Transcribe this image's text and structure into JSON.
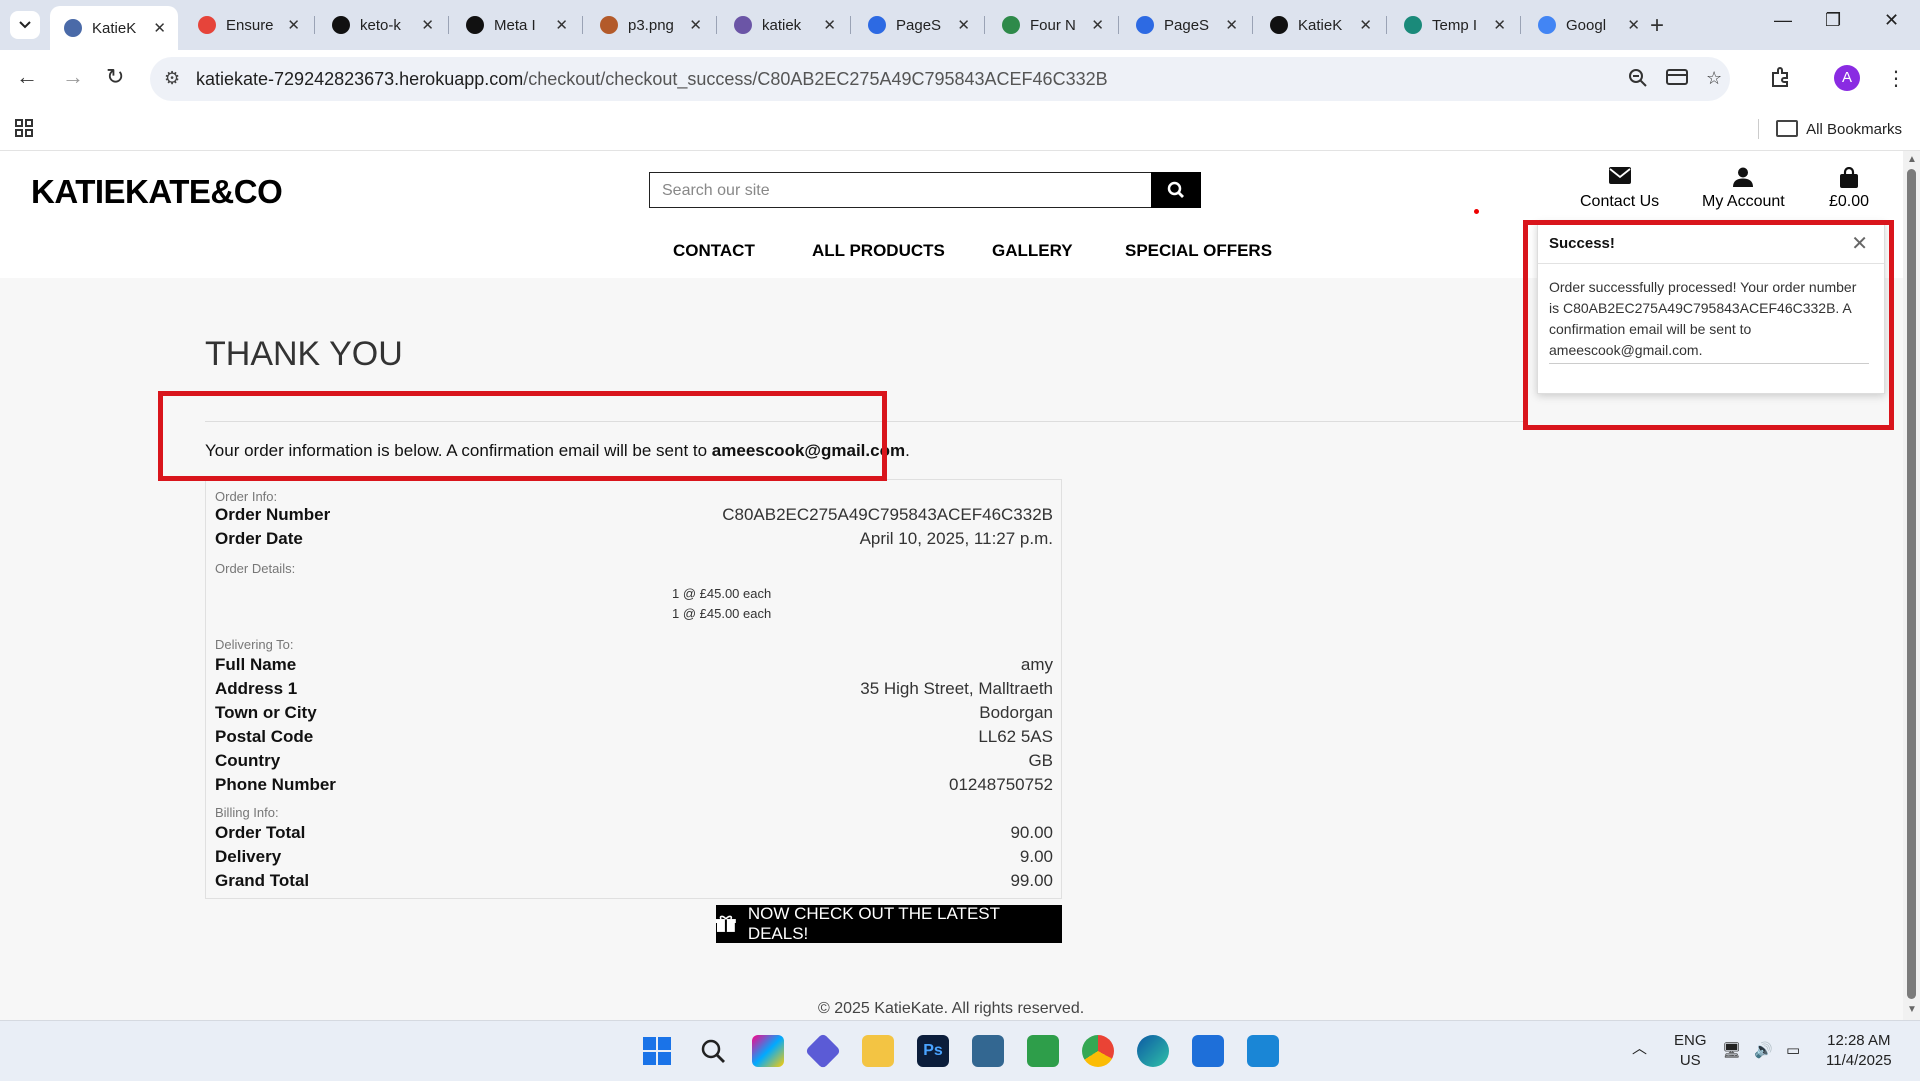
{
  "browser": {
    "tabs": [
      {
        "title": "KatieK",
        "active": true,
        "icon": "globe-icon",
        "color": "#4a6aa8"
      },
      {
        "title": "Ensure",
        "icon": "chrome-icon",
        "color": "#e6443a"
      },
      {
        "title": "keto-k",
        "icon": "github-icon",
        "color": "#111111"
      },
      {
        "title": "Meta I",
        "icon": "threads-icon",
        "color": "#111111"
      },
      {
        "title": "p3.png",
        "icon": "image-icon",
        "color": "#b35a2a"
      },
      {
        "title": "katiek",
        "icon": "heroku-icon",
        "color": "#6b55a6"
      },
      {
        "title": "PageS",
        "icon": "pagespeed-icon",
        "color": "#2d6ae3"
      },
      {
        "title": "Four N",
        "icon": "leaf-icon",
        "color": "#2e8a4a"
      },
      {
        "title": "PageS",
        "icon": "pagespeed-icon",
        "color": "#2d6ae3"
      },
      {
        "title": "KatieK",
        "icon": "github-icon",
        "color": "#111111"
      },
      {
        "title": "Temp I",
        "icon": "code-institute-icon",
        "color": "#1a8a7a"
      },
      {
        "title": "Googl",
        "icon": "google-icon",
        "color": "#4285f4"
      }
    ],
    "url_host": "katiekate-729242823673.herokuapp.com",
    "url_path": "/checkout/checkout_success/C80AB2EC275A49C795843ACEF46C332B",
    "avatar_letter": "A",
    "all_bookmarks": "All Bookmarks"
  },
  "site": {
    "logo": "KATIEKATE&CO",
    "search_placeholder": "Search our site",
    "contact_us": "Contact Us",
    "my_account": "My Account",
    "basket_total": "£0.00",
    "nav": [
      "CONTACT",
      "ALL PRODUCTS",
      "GALLERY",
      "SPECIAL OFFERS"
    ]
  },
  "page": {
    "title": "THANK YOU",
    "intro_text": "Your order information is below. A confirmation email will be sent to ",
    "intro_email": "ameescook@gmail.com",
    "intro_end": "."
  },
  "order": {
    "order_info_label": "Order Info:",
    "order_number_label": "Order Number",
    "order_number": "C80AB2EC275A49C795843ACEF46C332B",
    "order_date_label": "Order Date",
    "order_date": "April 10, 2025, 11:27 p.m.",
    "order_details_label": "Order Details:",
    "items": [
      "1 @ £45.00 each",
      "1 @ £45.00 each"
    ],
    "delivering_label": "Delivering To:",
    "full_name_label": "Full Name",
    "full_name": "amy",
    "address_label": "Address 1",
    "address": "35 High Street, Malltraeth",
    "town_label": "Town or City",
    "town": "Bodorgan",
    "postcode_label": "Postal Code",
    "postcode": "LL62 5AS",
    "country_label": "Country",
    "country": "GB",
    "phone_label": "Phone Number",
    "phone": "01248750752",
    "billing_label": "Billing Info:",
    "order_total_label": "Order Total",
    "order_total": "90.00",
    "delivery_label": "Delivery",
    "delivery": "9.00",
    "grand_total_label": "Grand Total",
    "grand_total": "99.00"
  },
  "deals_button": "NOW CHECK OUT THE LATEST DEALS!",
  "footer": "© 2025 KatieKate. All rights reserved.",
  "toast": {
    "title": "Success!",
    "message": "Order successfully processed! Your order number is C80AB2EC275A49C795843ACEF46C332B. A confirmation email will be sent to ameescook@gmail.com."
  },
  "taskbar": {
    "lang": "ENG",
    "region": "US",
    "time": "12:28 AM",
    "date": "11/4/2025"
  },
  "colors": {
    "annotation_red": "#d9151c",
    "button_black": "#000000"
  }
}
